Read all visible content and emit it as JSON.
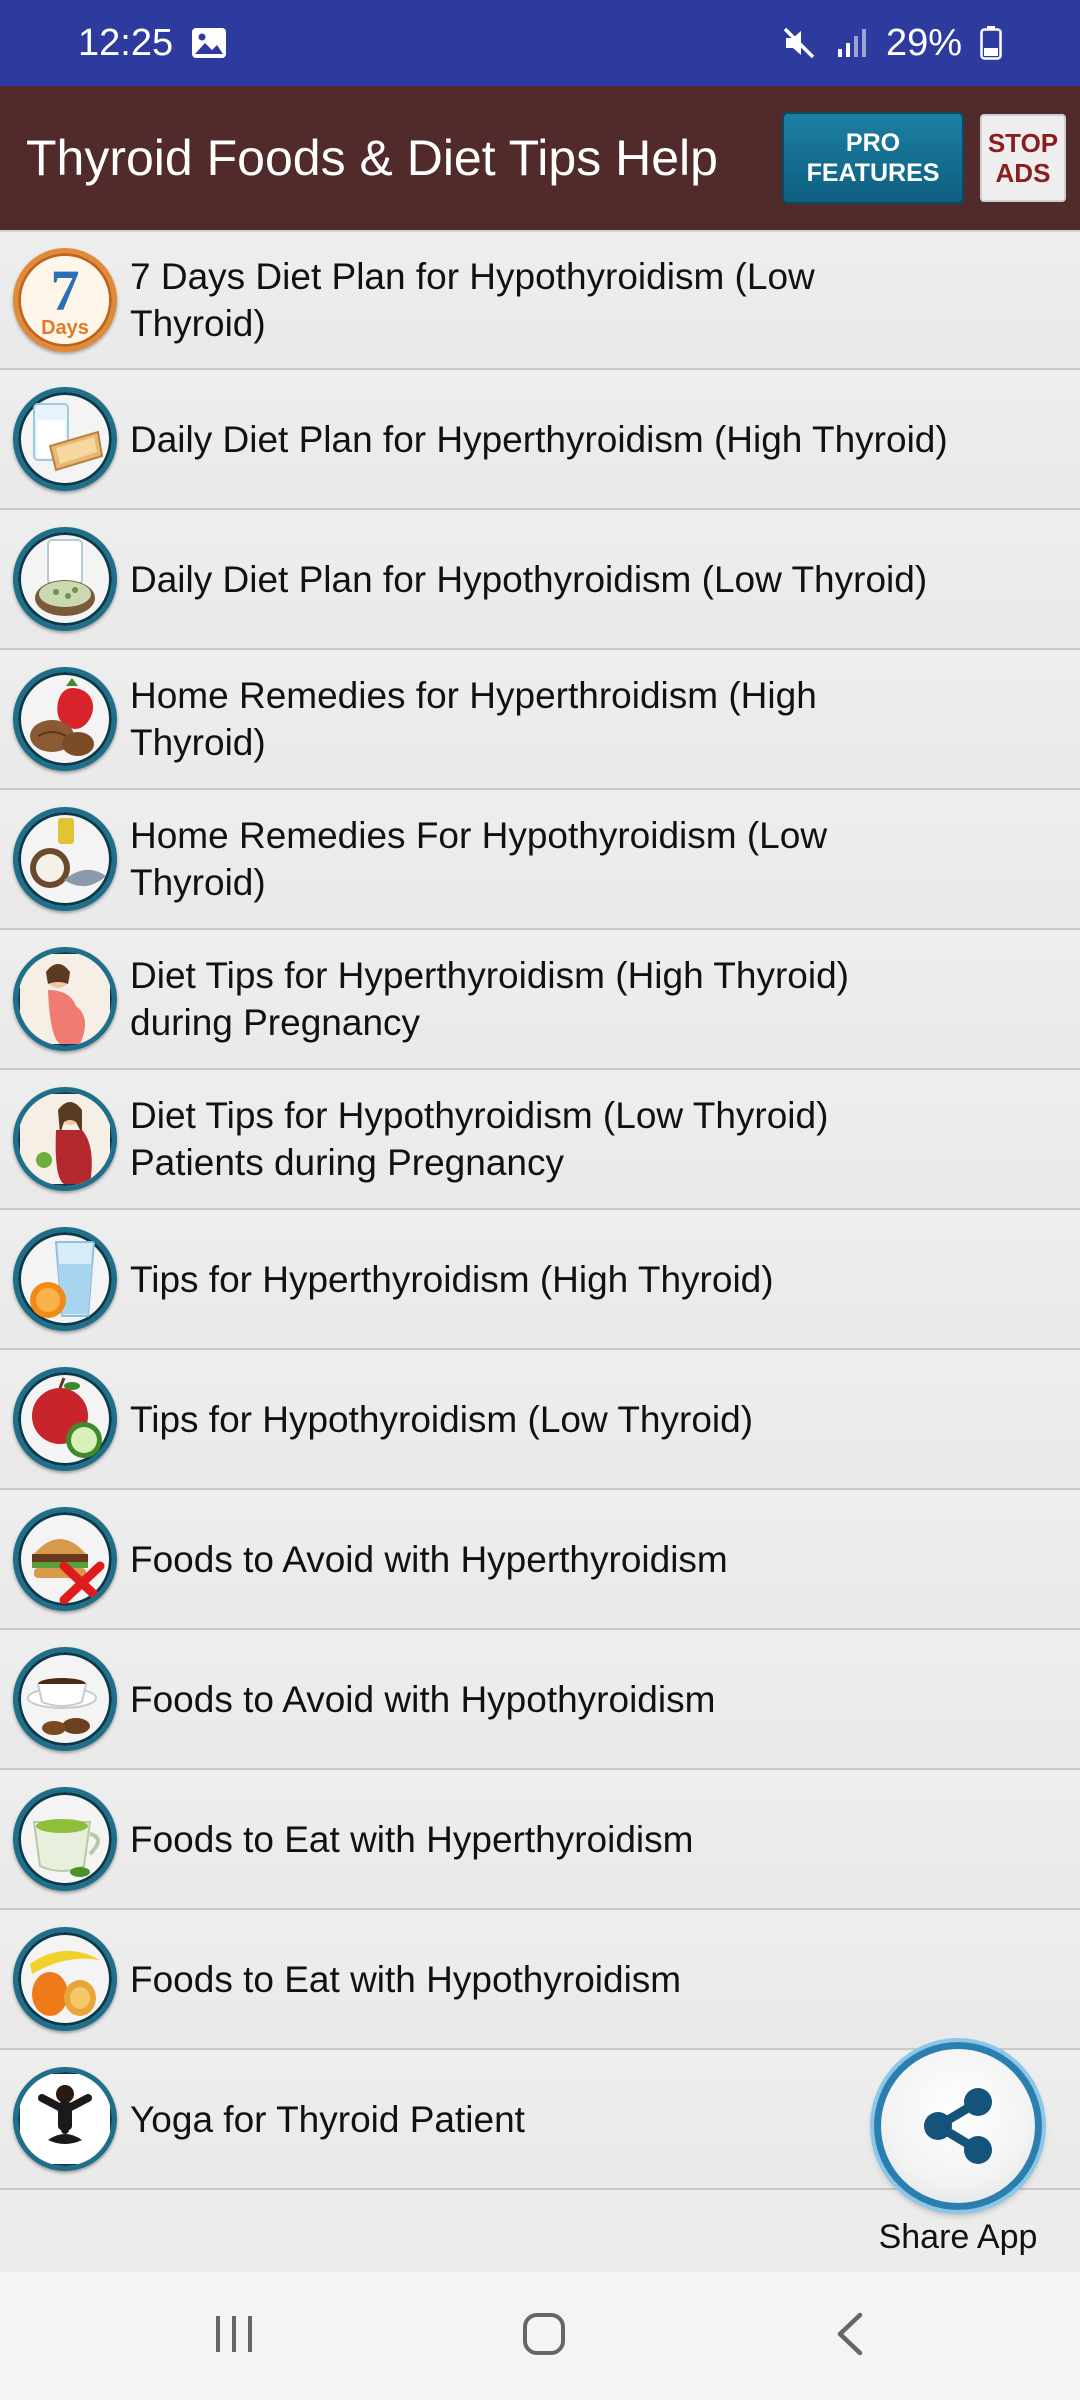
{
  "status_bar": {
    "time": "12:25",
    "battery": "29%"
  },
  "app_bar": {
    "title": "Thyroid Foods & Diet Tips Help",
    "pro_button": "PRO\nFEATURES",
    "stop_ads_button": "STOP\nADS"
  },
  "items": [
    {
      "label": "7 Days Diet Plan for Hypothyroidism (Low Thyroid)",
      "icon": "calendar-7-days-icon",
      "icon_text_top": "7",
      "icon_text_bottom": "Days"
    },
    {
      "label": "Daily Diet Plan for Hyperthyroidism (High Thyroid)",
      "icon": "milk-toast-icon"
    },
    {
      "label": "Daily Diet Plan for Hypothyroidism (Low Thyroid)",
      "icon": "milk-seeds-icon"
    },
    {
      "label": "Home Remedies for Hyperthroidism (High Thyroid)",
      "icon": "strawberry-walnut-icon"
    },
    {
      "label": "Home Remedies For Hypothyroidism (Low Thyroid)",
      "icon": "coconut-oil-fish-icon"
    },
    {
      "label": "Diet Tips for Hyperthyroidism (High Thyroid) during Pregnancy",
      "icon": "pregnant-woman-icon"
    },
    {
      "label": "Diet Tips for Hypothyroidism (Low Thyroid) Patients during Pregnancy",
      "icon": "pregnant-woman-eating-icon"
    },
    {
      "label": "Tips for Hyperthyroidism (High Thyroid)",
      "icon": "water-orange-icon"
    },
    {
      "label": "Tips for Hypothyroidism (Low Thyroid)",
      "icon": "apple-cucumber-icon"
    },
    {
      "label": "Foods to Avoid with Hyperthyroidism",
      "icon": "burger-avoid-icon"
    },
    {
      "label": "Foods to Avoid with Hypothyroidism",
      "icon": "coffee-avoid-icon"
    },
    {
      "label": "Foods to Eat with Hyperthyroidism",
      "icon": "green-tea-icon"
    },
    {
      "label": "Foods to Eat with Hypothyroidism",
      "icon": "fruits-icon"
    },
    {
      "label": "Yoga for Thyroid Patient",
      "icon": "yoga-icon"
    }
  ],
  "share": {
    "label": "Share App",
    "icon": "share-icon"
  },
  "nav": {
    "recents_icon": "recents-icon",
    "home_icon": "home-icon",
    "back_icon": "back-icon"
  },
  "colors": {
    "status_bar": "#2e3b9e",
    "app_bar": "#512b2b",
    "pro_button": "#1b7fa3",
    "stop_ads_text": "#8a1d1d",
    "icon_ring": "#1f6e8a"
  }
}
